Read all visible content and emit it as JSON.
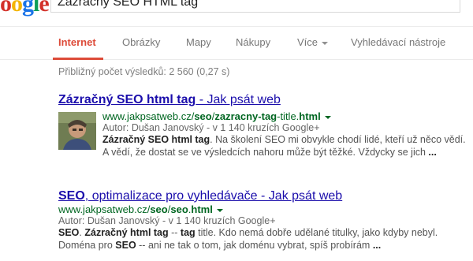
{
  "header": {
    "logo_letters": [
      "o",
      "o",
      "g",
      "l",
      "e"
    ],
    "search_query": "Zázračný SEO HTML tag"
  },
  "nav": {
    "tabs": [
      {
        "label": "Internet"
      },
      {
        "label": "Obrázky"
      },
      {
        "label": "Mapy"
      },
      {
        "label": "Nákupy"
      },
      {
        "label": "Více"
      },
      {
        "label": "Vyhledávací nástroje"
      }
    ]
  },
  "stats": "Přibližný počet výsledků: 2 560 (0,27 s)",
  "results": [
    {
      "title_b1": "Zázračný SEO html tag",
      "title_rest": " - Jak psát web",
      "url_pre": "www.jakpsatweb.cz/",
      "url_b1": "seo",
      "url_mid": "/",
      "url_b2": "zazracny-tag",
      "url_mid2": "-title.",
      "url_b3": "html",
      "author": "Autor: Dušan Janovský - v 1 140 kruzích Google+",
      "snippet": [
        {
          "b": true,
          "t": "Zázračný SEO html tag"
        },
        {
          "b": false,
          "t": ". Na školení SEO mi obvykle chodí lidé, kteří už něco vědí. A vědí, že dostat se ve výsledcích nahoru může být těžké. Vždycky se jich "
        },
        {
          "b": true,
          "t": "..."
        }
      ]
    },
    {
      "title_b1": "SEO",
      "title_rest": ", optimalizace pro vyhledávače - Jak psát web",
      "url_pre": "www.jakpsatweb.cz/",
      "url_b1": "seo",
      "url_mid": "/",
      "url_b2": "seo",
      "url_mid2": ".",
      "url_b3": "html",
      "author": "Autor: Dušan Janovský - v 1 140 kruzích Google+",
      "snippet": [
        {
          "b": true,
          "t": "SEO"
        },
        {
          "b": false,
          "t": ". "
        },
        {
          "b": true,
          "t": "Zázračný html tag"
        },
        {
          "b": false,
          "t": " -- "
        },
        {
          "b": true,
          "t": "tag"
        },
        {
          "b": false,
          "t": " title. Kdo nemá dobře udělané titulky, jako kdyby nebyl. Doména pro "
        },
        {
          "b": true,
          "t": "SEO"
        },
        {
          "b": false,
          "t": " -- ani ne tak o tom, jak doménu vybrat, spíš probírám "
        },
        {
          "b": true,
          "t": "..."
        }
      ]
    }
  ]
}
